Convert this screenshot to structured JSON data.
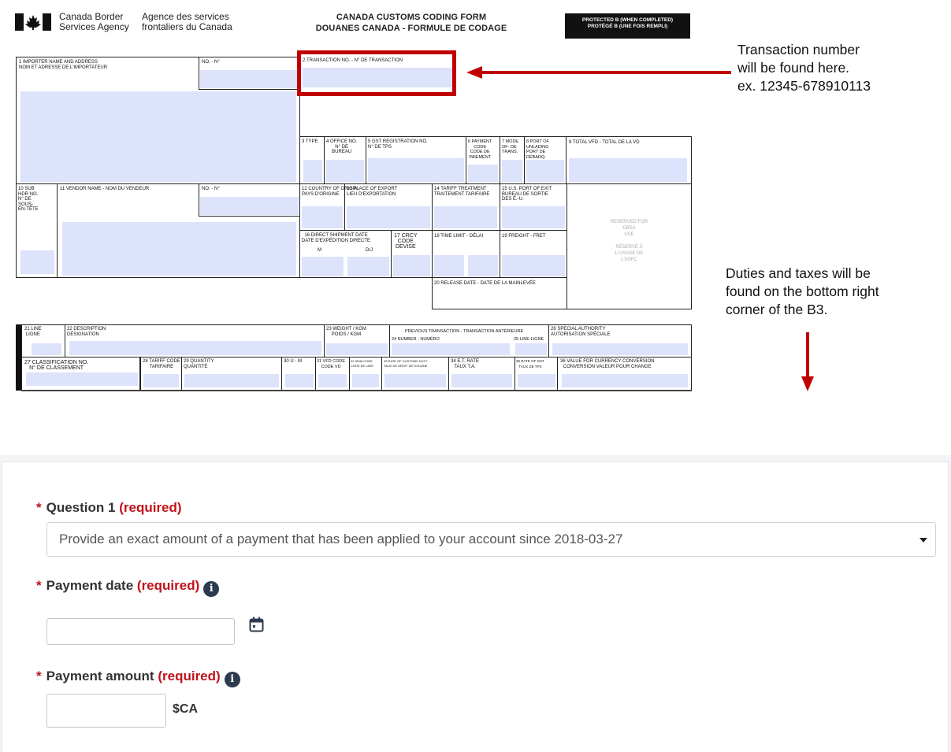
{
  "form_image": {
    "agency_en": [
      "Canada Border",
      "Services Agency"
    ],
    "agency_fr": [
      "Agence des services",
      "frontaliers du Canada"
    ],
    "title_line1": "CANADA CUSTOMS CODING FORM",
    "title_line2": "DOUANES CANADA - FORMULE DE CODAGE",
    "protected_line1": "PROTECTED B (WHEN COMPLETED)",
    "protected_line2": "PROTÉGÉ B (UNE FOIS REMPLI)",
    "fields": {
      "f1": "1 IMPORTER NAME AND ADDRESS\nNOM ET ADRESSE DE L'IMPORTATEUR",
      "no1": "NO. - N°",
      "f2": "2.TRANSACTION NO. - N° DE TRANSACTION",
      "f3": "3 TYPE",
      "f4": "4 OFFICE NO.\nN° DE\nBUREAU",
      "f5": "5 GST REGISTRATION NO.\nN° DE TPS",
      "f6": "6 PAYMENT\nCODE\nCODE DE\nPAIEMENT",
      "f7": "7 MODE\nOF- DE\nTRANS.",
      "f8": "8 PORT OF\nUNLADING\nPORT DE\nDÉBARQ.",
      "f9": "9 TOTAL VFD - TOTAL DE LA VD",
      "f10": "10 SUB\nHDR NO.\nN° DE\nSOUS-\nEN-TÊTE",
      "f11": "11 VENDOR NAME - NOM DU VENDEUR",
      "no11": "NO. - N°",
      "f12": "12 COUNTRY OF ORIGIN\nPAYS D'ORIGINE",
      "f13": "13 PLACE OF EXPORT\nLIEU D'EXPORTATION",
      "f14": "14 TARIFF TREATMENT\nTRAITEMENT TARIFAIRE",
      "f15": "15 U.S. PORT OF EXIT\nBUREAU DE SORTIE\nDES É.-U.",
      "f16": "16 DIRECT SHIPMENT DATE\nDATE D'EXPÉDITION DIRECTE",
      "f16m": "M",
      "f16d": "D/J",
      "f17": "17 CRCY\nCODE\nDEVISE",
      "f18": "18 TIME LIMIT - DÉLAI",
      "f19": "19 FREIGHT - FRET",
      "f20": "20 RELEASE DATE - DATE DE LA MAINLEVÉE",
      "reserved": "RESERVED FOR\nCBSA\nUSE\n\nRÉSERVÉ À\nL'USAGE DE\nL'ASFC",
      "f21": "21 LINE\nLIGNE",
      "f22": "22 DESCRIPTION\nDÉSIGNATION",
      "f23": "23 WEIGHT / KGM\nPOIDS / KGM",
      "prev": "PREVIOUS TRANSACTION - TRANSACTION ANTÉRIEURE",
      "f24": "24 NUMBER - NUMÉRO",
      "f25": "25 LINE-LIGNE",
      "f26": "26 SPECIAL AUTHORITY\nAUTORISATION SPÉCIALE",
      "f27": "27 CLASSIFICATION NO.\nN° DE CLASSEMENT",
      "f28": "28 TARIFF CODE\nTARIFAIRE",
      "f29": "29 QUANTITY\nQUANTITÉ",
      "f30": "30 U - M",
      "f31": "31 VFD CODE\nCODE VD",
      "f32": "32 SIMA CODE\nCODE DE LMSI",
      "f33": "33 RATE OF CUSTOMS DUTY\nTAUX DE DROIT DE DOUANE",
      "f34": "34 E.T. RATE\nTAUX T.A.",
      "f35": "35 RATE OF GST\nTAUX DE TPS",
      "f36": "36 VALUE FOR CURRENCY CONVERSION\nCONVERSION VALEUR POUR CHANGE"
    }
  },
  "annotations": {
    "transaction_note": [
      "Transaction number",
      "will be found here.",
      "ex. 12345-678910113"
    ],
    "duties_note": [
      "Duties and taxes will be",
      "found on the bottom right",
      "corner of the B3."
    ],
    "highlight_color": "#c00000"
  },
  "web_form": {
    "question1": {
      "star": "*",
      "label": "Question 1",
      "required": "(required)",
      "selected": "Provide an exact amount of a payment that has been applied to your account since 2018-03-27"
    },
    "payment_date": {
      "star": "*",
      "label": "Payment date",
      "required": "(required)",
      "info_icon": "i",
      "value": "",
      "calendar_icon": "calendar-icon"
    },
    "payment_amount": {
      "star": "*",
      "label": "Payment amount",
      "required": "(required)",
      "info_icon": "i",
      "value": "",
      "currency": "$CA"
    },
    "colors": {
      "required": "#c0121a",
      "info_icon_bg": "#2d3b4e"
    }
  }
}
